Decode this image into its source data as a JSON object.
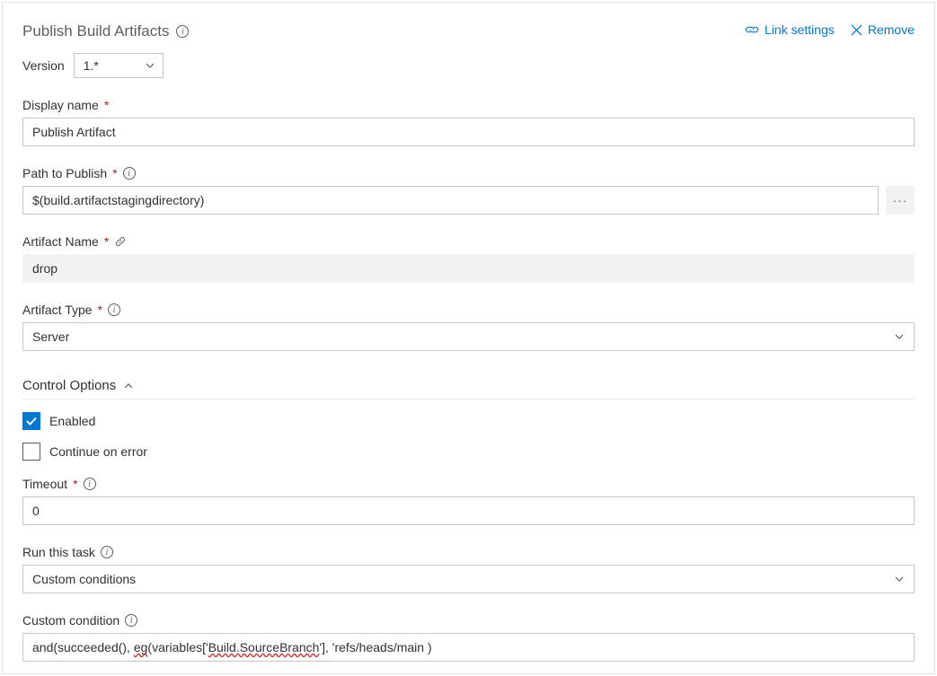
{
  "header": {
    "title": "Publish Build Artifacts",
    "actions": {
      "link_settings": "Link settings",
      "remove": "Remove"
    }
  },
  "version": {
    "label": "Version",
    "value": "1.*"
  },
  "fields": {
    "display_name": {
      "label": "Display name",
      "value": "Publish Artifact",
      "required": true
    },
    "path_to_publish": {
      "label": "Path to Publish",
      "value": "$(build.artifactstagingdirectory)",
      "required": true,
      "browse_aria": "Browse"
    },
    "artifact_name": {
      "label": "Artifact Name",
      "value": "drop",
      "required": true
    },
    "artifact_type": {
      "label": "Artifact Type",
      "value": "Server",
      "required": true
    }
  },
  "control_options": {
    "section_label": "Control Options",
    "enabled": {
      "label": "Enabled",
      "checked": true
    },
    "continue_on_error": {
      "label": "Continue on error",
      "checked": false
    },
    "timeout": {
      "label": "Timeout",
      "value": "0",
      "required": true
    },
    "run_this_task": {
      "label": "Run this task",
      "value": "Custom conditions"
    },
    "custom_condition": {
      "label": "Custom condition",
      "prefix": "and(succeeded(), ",
      "func": "eg",
      "mid1": "(variables['",
      "squiggle": "Build.SourceBranch",
      "mid2": "'], 'refs/heads/main )"
    }
  }
}
